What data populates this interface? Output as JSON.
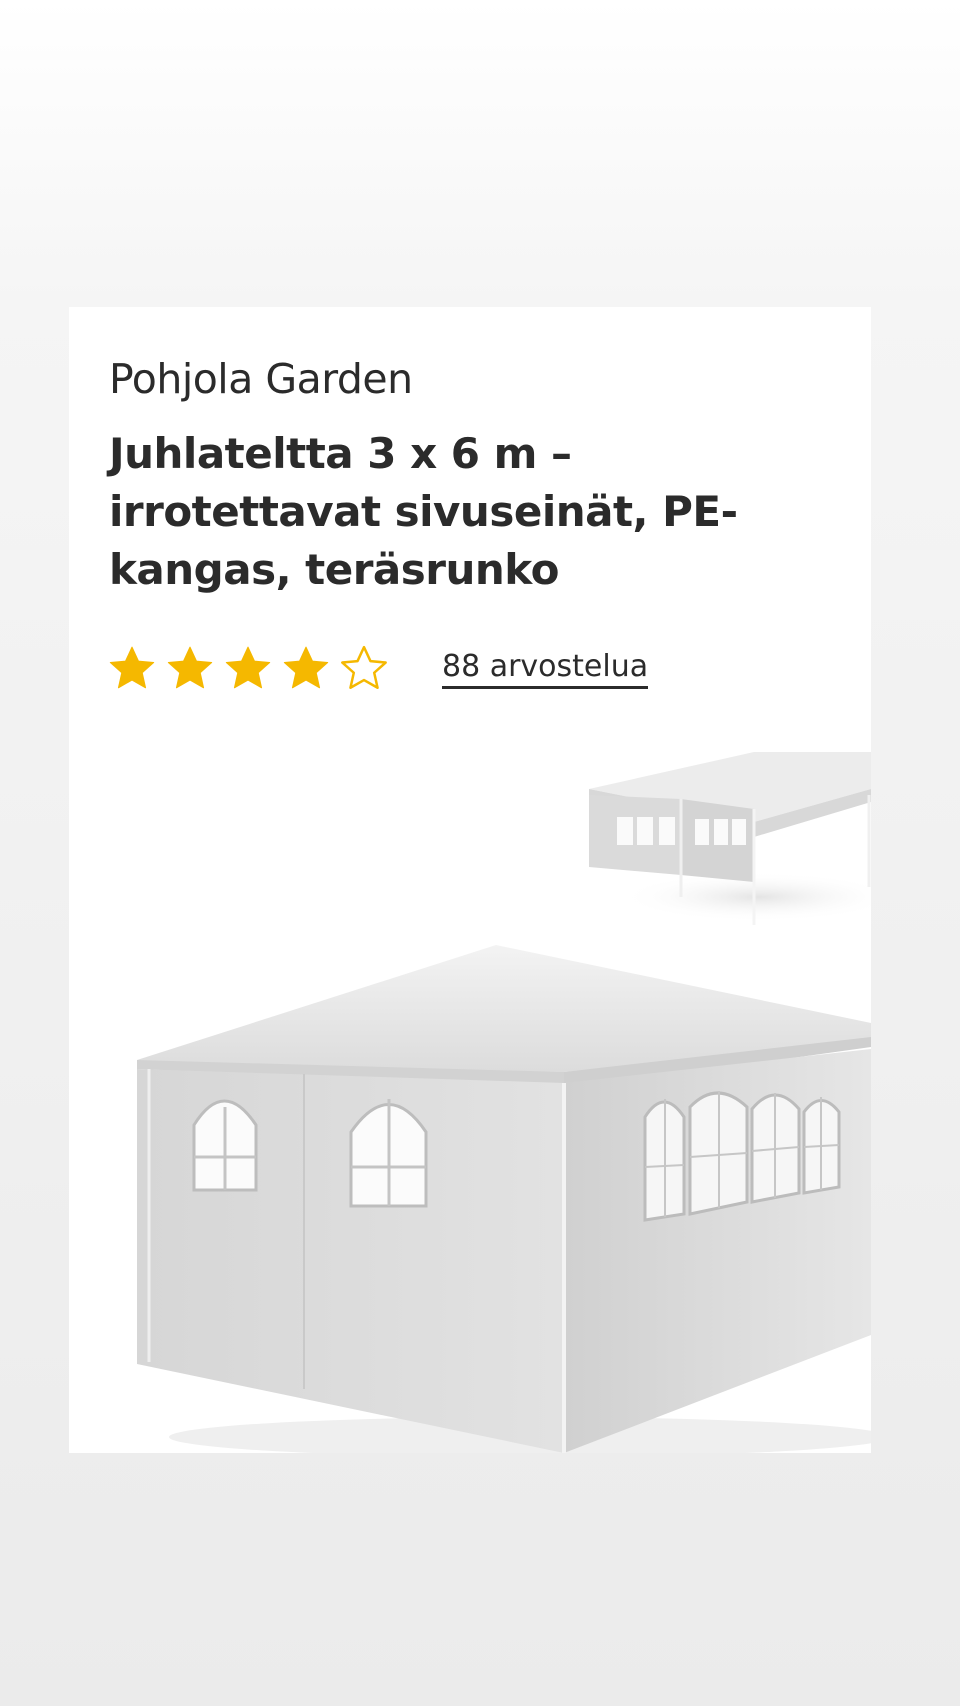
{
  "product": {
    "brand": "Pohjola Garden",
    "title": "Juhlateltta 3 x 6 m – irrotettavat sivuseinät, PE-kangas, teräsrunko",
    "rating": 4,
    "rating_max": 5,
    "review_link": "88 arvostelua",
    "image_icon": "party-tent-image"
  },
  "colors": {
    "star": "#F5B800",
    "text": "#2B2B2B",
    "card": "#FFFFFF"
  }
}
